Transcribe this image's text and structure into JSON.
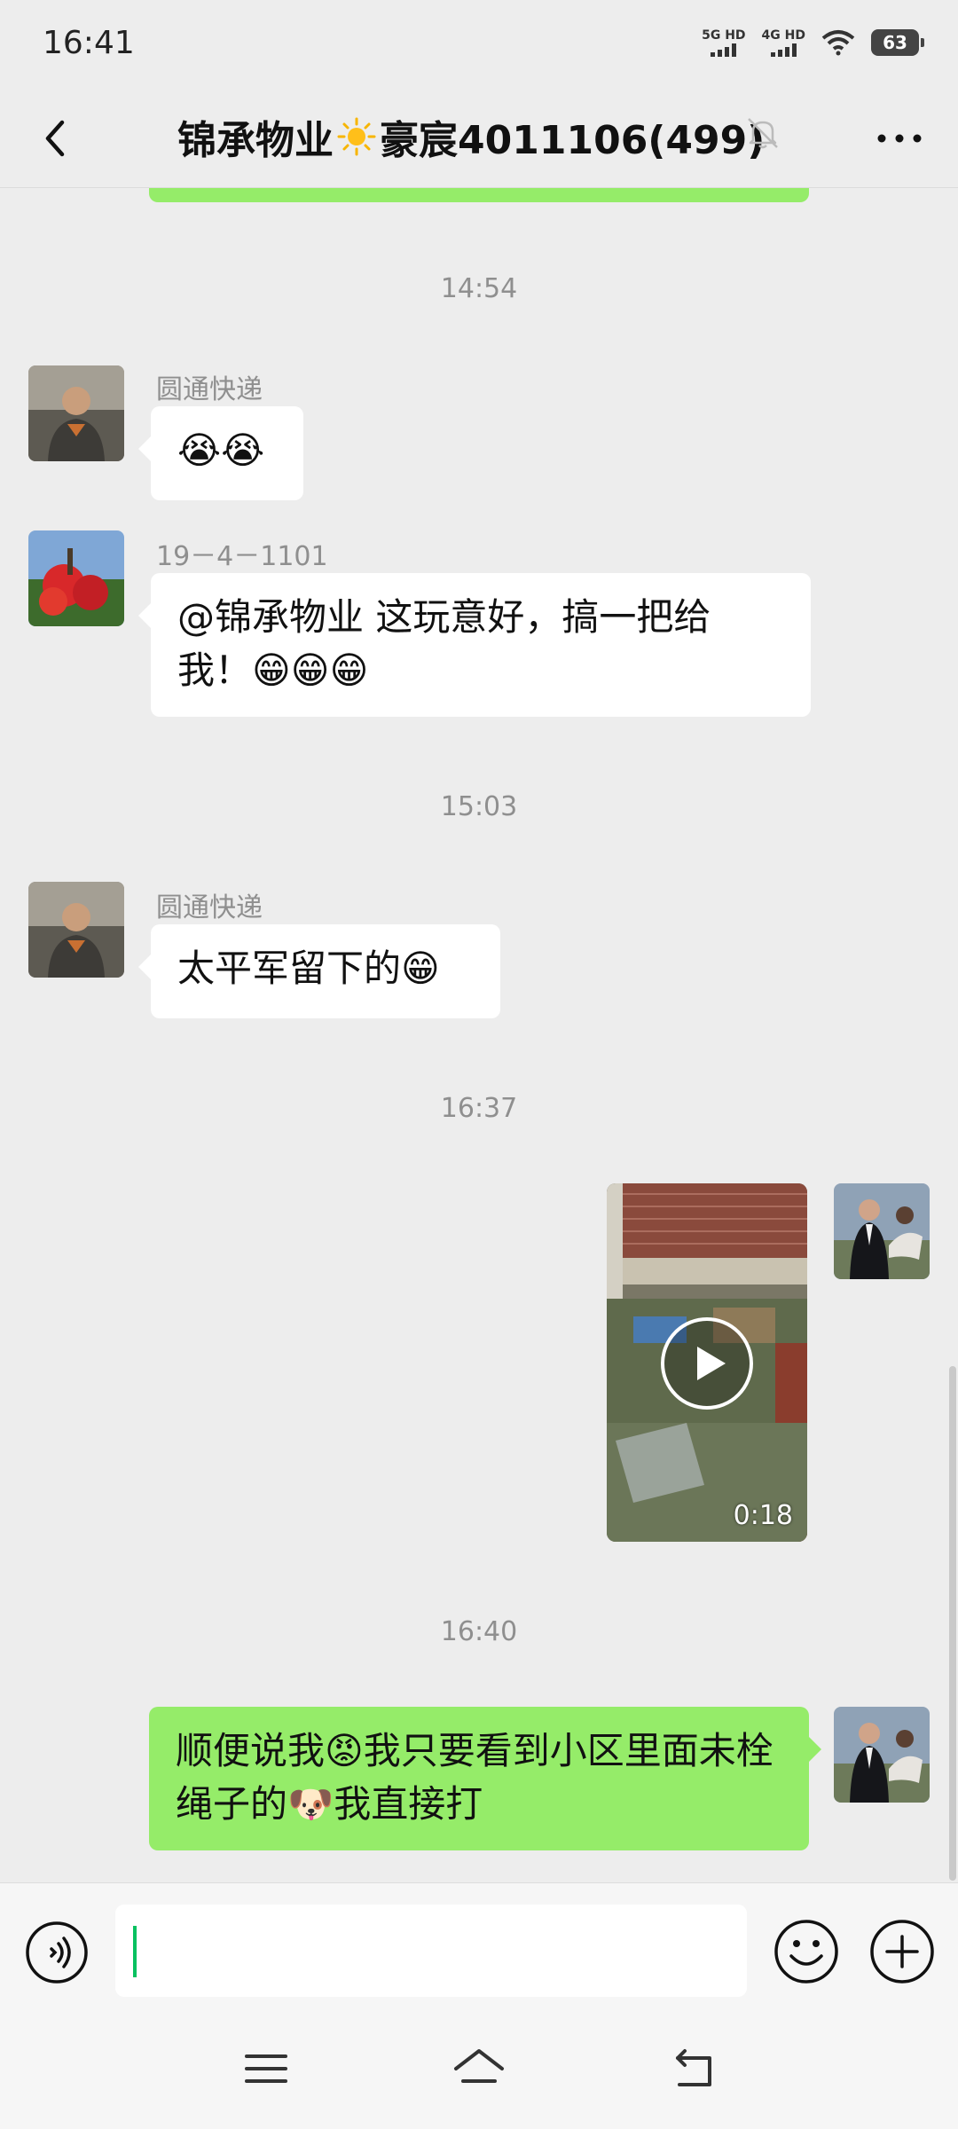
{
  "status_bar": {
    "time": "16:41",
    "signal1_label": "5G HD",
    "signal2_label": "4G HD",
    "battery": "63"
  },
  "header": {
    "title_part1": "锦承物业",
    "title_part2": "豪宸4011106(499)"
  },
  "messages": [
    {
      "type": "timestamp",
      "text": "14:54"
    },
    {
      "type": "incoming",
      "sender": "圆通快递",
      "text": "😭😭"
    },
    {
      "type": "incoming",
      "sender": "19－4－1101",
      "text": "@锦承物业  这玩意好，搞一把给我！😁😁😁"
    },
    {
      "type": "timestamp",
      "text": "15:03"
    },
    {
      "type": "incoming",
      "sender": "圆通快递",
      "text": "太平军留下的😁"
    },
    {
      "type": "timestamp",
      "text": "16:37"
    },
    {
      "type": "outgoing_video",
      "duration": "0:18"
    },
    {
      "type": "timestamp",
      "text": "16:40"
    },
    {
      "type": "outgoing",
      "text": "顺便说我😡我只要看到小区里面未栓绳子的🐶我直接打"
    }
  ],
  "icons": {
    "back": "chevron-left-icon",
    "mute": "bell-off-icon",
    "more": "more-icon",
    "voice": "voice-icon",
    "emoji": "emoji-icon",
    "plus": "plus-icon"
  },
  "colors": {
    "background": "#ededed",
    "outgoing_bubble": "#95ec69",
    "incoming_bubble": "#ffffff",
    "cursor": "#07c160"
  }
}
